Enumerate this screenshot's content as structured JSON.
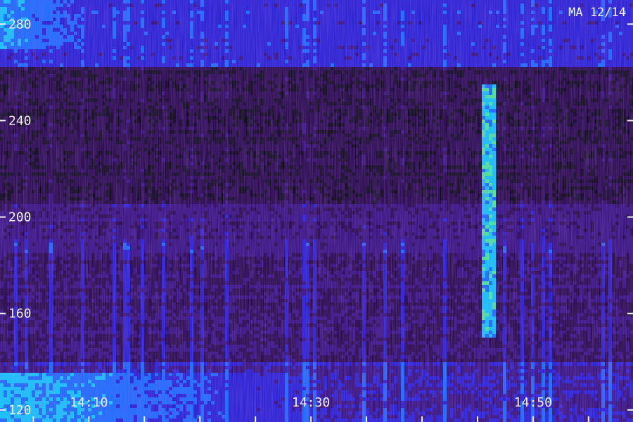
{
  "chart_data": {
    "type": "heatmap",
    "title": "",
    "station_label": "MA 12/14",
    "xlabel": "",
    "ylabel": "",
    "x_range": [
      "14:02",
      "14:59"
    ],
    "y_range": [
      115,
      290
    ],
    "y_ticks": [
      {
        "value": 280,
        "label": "280"
      },
      {
        "value": 240,
        "label": "240"
      },
      {
        "value": 200,
        "label": "200"
      },
      {
        "value": 160,
        "label": "160"
      },
      {
        "value": 120,
        "label": "120"
      }
    ],
    "x_ticks": [
      {
        "value": "14:10",
        "label": "14:10"
      },
      {
        "value": "14:30",
        "label": "14:30"
      },
      {
        "value": "14:50",
        "label": "14:50"
      }
    ],
    "colormap": [
      "#000000",
      "#1a0033",
      "#2a0a6e",
      "#1a1ad0",
      "#0a70ff",
      "#00d8ff",
      "#40ff90",
      "#d0ff20"
    ],
    "features": [
      {
        "name": "burst",
        "time": "14:46",
        "y_range": [
          150,
          255
        ],
        "intensity": 0.85
      },
      {
        "name": "band-high",
        "time_range": [
          "14:02",
          "14:14"
        ],
        "y_range": [
          270,
          290
        ],
        "intensity": 0.75
      },
      {
        "name": "band-low",
        "time_range": [
          "14:02",
          "14:30"
        ],
        "y_range": [
          115,
          135
        ],
        "intensity": 0.8
      }
    ]
  }
}
